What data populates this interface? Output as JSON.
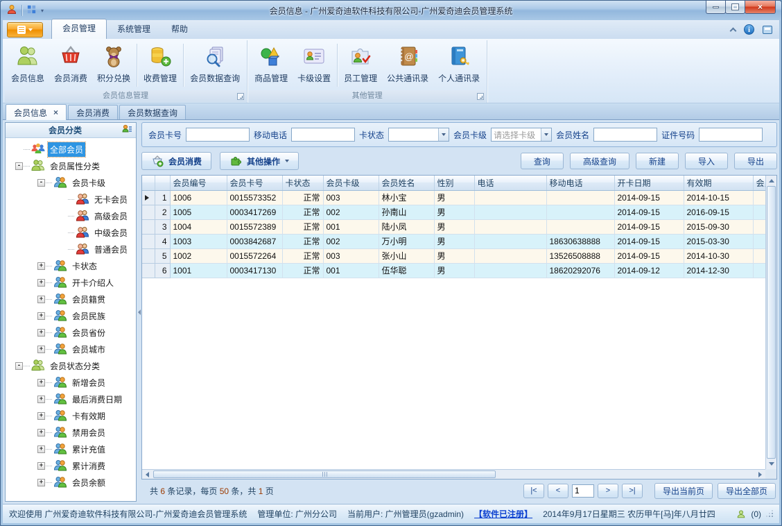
{
  "window": {
    "title": "会员信息 - 广州爱奇迪软件科技有限公司-广州爱奇迪会员管理系统"
  },
  "theme": {
    "accent_orange": "#f39c12",
    "titlebar_blue": "#9fc0e2",
    "selection_blue": "#2e95e3",
    "row_stripe_warm": "#fdf8ec",
    "row_stripe_cool": "#d8f2fa",
    "link_blue": "#0a3fd0",
    "pager_number_red": "#9c3a00"
  },
  "menu": {
    "tabs": [
      {
        "label": "会员管理",
        "active": true
      },
      {
        "label": "系统管理",
        "active": false
      },
      {
        "label": "帮助",
        "active": false
      }
    ]
  },
  "ribbon": {
    "groups": [
      {
        "caption": "会员信息管理",
        "items": [
          {
            "label": "会员信息",
            "icon": "members-icon",
            "name": "member-info"
          },
          {
            "label": "会员消费",
            "icon": "basket-icon",
            "name": "member-consume"
          },
          {
            "label": "积分兑换",
            "icon": "bear-icon",
            "name": "points-exchange"
          },
          {
            "divider": true
          },
          {
            "label": "收费管理",
            "icon": "coins-icon",
            "name": "fee-management"
          },
          {
            "divider": true
          },
          {
            "label": "会员数据查询",
            "icon": "doc-search-icon",
            "name": "member-data-query"
          }
        ]
      },
      {
        "caption": "其他管理",
        "items": [
          {
            "label": "商品管理",
            "icon": "products-icon",
            "name": "product-management"
          },
          {
            "label": "卡级设置",
            "icon": "card-icon",
            "name": "card-level-settings"
          },
          {
            "divider": true
          },
          {
            "label": "员工管理",
            "icon": "staff-icon",
            "name": "staff-management"
          },
          {
            "label": "公共通讯录",
            "icon": "public-contacts-icon",
            "name": "public-contacts"
          },
          {
            "label": "个人通讯录",
            "icon": "personal-contacts-icon",
            "name": "personal-contacts"
          }
        ]
      }
    ]
  },
  "doc_tabs": [
    {
      "label": "会员信息",
      "active": true,
      "closable": true
    },
    {
      "label": "会员消费",
      "active": false,
      "closable": false
    },
    {
      "label": "会员数据查询",
      "active": false,
      "closable": false
    }
  ],
  "sidebar": {
    "title": "会员分类",
    "tree": [
      {
        "label": "全部会员",
        "level": 0,
        "exp": "",
        "icon": "group",
        "selected": true
      },
      {
        "label": "会员属性分类",
        "level": 0,
        "exp": "-",
        "icon": "cat",
        "selected": false
      },
      {
        "label": "会员卡级",
        "level": 1,
        "exp": "-",
        "icon": "sub",
        "selected": false
      },
      {
        "label": "无卡会员",
        "level": 2,
        "exp": "",
        "icon": "leaf",
        "selected": false
      },
      {
        "label": "高级会员",
        "level": 2,
        "exp": "",
        "icon": "leaf",
        "selected": false
      },
      {
        "label": "中级会员",
        "level": 2,
        "exp": "",
        "icon": "leaf",
        "selected": false
      },
      {
        "label": "普通会员",
        "level": 2,
        "exp": "",
        "icon": "leaf",
        "selected": false
      },
      {
        "label": "卡状态",
        "level": 1,
        "exp": "+",
        "icon": "sub",
        "selected": false
      },
      {
        "label": "开卡介绍人",
        "level": 1,
        "exp": "+",
        "icon": "sub",
        "selected": false
      },
      {
        "label": "会员籍贯",
        "level": 1,
        "exp": "+",
        "icon": "sub",
        "selected": false
      },
      {
        "label": "会员民族",
        "level": 1,
        "exp": "+",
        "icon": "sub",
        "selected": false
      },
      {
        "label": "会员省份",
        "level": 1,
        "exp": "+",
        "icon": "sub",
        "selected": false
      },
      {
        "label": "会员城市",
        "level": 1,
        "exp": "+",
        "icon": "sub",
        "selected": false
      },
      {
        "label": "会员状态分类",
        "level": 0,
        "exp": "-",
        "icon": "cat",
        "selected": false
      },
      {
        "label": "新增会员",
        "level": 1,
        "exp": "+",
        "icon": "sub",
        "selected": false
      },
      {
        "label": "最后消费日期",
        "level": 1,
        "exp": "+",
        "icon": "sub",
        "selected": false
      },
      {
        "label": "卡有效期",
        "level": 1,
        "exp": "+",
        "icon": "sub",
        "selected": false
      },
      {
        "label": "禁用会员",
        "level": 1,
        "exp": "+",
        "icon": "sub",
        "selected": false
      },
      {
        "label": "累计充值",
        "level": 1,
        "exp": "+",
        "icon": "sub",
        "selected": false
      },
      {
        "label": "累计消费",
        "level": 1,
        "exp": "+",
        "icon": "sub",
        "selected": false
      },
      {
        "label": "会员余额",
        "level": 1,
        "exp": "+",
        "icon": "sub",
        "selected": false
      }
    ]
  },
  "filters": [
    {
      "label": "会员卡号",
      "type": "input",
      "value": "",
      "name": "card-number"
    },
    {
      "label": "移动电话",
      "type": "input",
      "value": "",
      "name": "mobile"
    },
    {
      "label": "卡状态",
      "type": "combo",
      "value": "",
      "name": "card-status"
    },
    {
      "label": "会员卡级",
      "type": "combo",
      "value": "请选择卡级",
      "name": "card-level"
    },
    {
      "label": "会员姓名",
      "type": "input",
      "value": "",
      "name": "member-name"
    },
    {
      "label": "证件号码",
      "type": "input",
      "value": "",
      "name": "id-number"
    }
  ],
  "toolbar": {
    "consume_button": "会员消费",
    "more_button": "其他操作",
    "actions": [
      {
        "label": "查询",
        "name": "query"
      },
      {
        "label": "高级查询",
        "name": "advanced-query"
      },
      {
        "label": "新建",
        "name": "create"
      },
      {
        "label": "导入",
        "name": "import"
      },
      {
        "label": "导出",
        "name": "export"
      }
    ]
  },
  "grid": {
    "columns": [
      "会员编号",
      "会员卡号",
      "卡状态",
      "会员卡级",
      "会员姓名",
      "性别",
      "电话",
      "移动电话",
      "开卡日期",
      "有效期",
      "会员"
    ],
    "column_keys": [
      "member-id",
      "card-no",
      "card-status",
      "card-level",
      "member-name",
      "gender",
      "phone",
      "mobile",
      "open-date",
      "valid-until",
      "member-extra"
    ],
    "rows": [
      [
        "1",
        "1006",
        "0015573352",
        "正常",
        "003",
        "林小宝",
        "男",
        "",
        "",
        "2014-09-15",
        "2014-10-15",
        ""
      ],
      [
        "2",
        "1005",
        "0003417269",
        "正常",
        "002",
        "孙南山",
        "男",
        "",
        "",
        "2014-09-15",
        "2016-09-15",
        ""
      ],
      [
        "3",
        "1004",
        "0015572389",
        "正常",
        "001",
        "陆小凤",
        "男",
        "",
        "",
        "2014-09-15",
        "2015-09-30",
        ""
      ],
      [
        "4",
        "1003",
        "0003842687",
        "正常",
        "002",
        "万小明",
        "男",
        "",
        "18630638888",
        "2014-09-15",
        "2015-03-30",
        ""
      ],
      [
        "5",
        "1002",
        "0015572264",
        "正常",
        "003",
        "张小山",
        "男",
        "",
        "13526508888",
        "2014-09-15",
        "2014-10-30",
        ""
      ],
      [
        "6",
        "1001",
        "0003417130",
        "正常",
        "001",
        "伍华聪",
        "男",
        "",
        "18620292076",
        "2014-09-12",
        "2014-12-30",
        ""
      ]
    ]
  },
  "pager": {
    "summary": [
      {
        "t": "共 "
      },
      {
        "t": "6",
        "num": true
      },
      {
        "t": " 条记录，每页 "
      },
      {
        "t": "50",
        "num": true
      },
      {
        "t": " 条，共 "
      },
      {
        "t": "1",
        "num": true
      },
      {
        "t": " 页"
      }
    ],
    "first": "|<",
    "prev": "<",
    "page": "1",
    "next": ">",
    "last": ">|",
    "export_current": "导出当前页",
    "export_all": "导出全部页"
  },
  "statusbar": {
    "welcome": "欢迎使用 广州爱奇迪软件科技有限公司-广州爱奇迪会员管理系统",
    "org": "管理单位: 广州分公司",
    "user": "当前用户: 广州管理员(gzadmin)",
    "registered": "【软件已注册】",
    "date": "2014年9月17日星期三 农历甲午[马]年八月廿四",
    "messages": "(0)"
  }
}
